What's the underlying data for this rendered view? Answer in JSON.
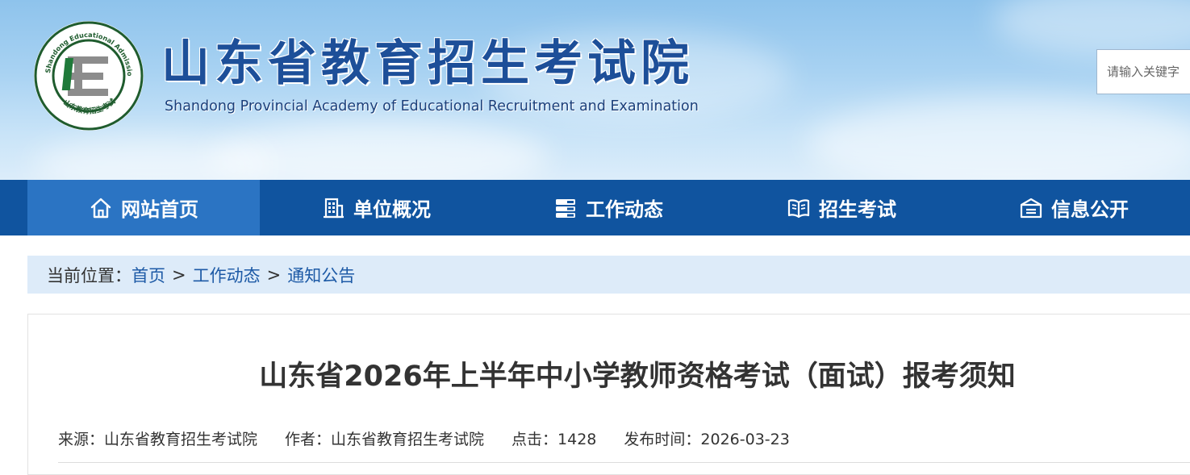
{
  "header": {
    "brand_cn": "山东省教育招生考试院",
    "brand_en": "Shandong Provincial Academy of Educational Recruitment and Examination",
    "logo": {
      "ring_text_top": "Shandong Educational Admission & Examination",
      "ring_text_bottom": "山东教育招生考试",
      "icon": "sdeea-logo-icon"
    },
    "search_placeholder": "请输入关键字"
  },
  "nav": {
    "items": [
      {
        "label": "网站首页",
        "icon": "home-icon",
        "active": true
      },
      {
        "label": "单位概况",
        "icon": "building-icon",
        "active": false
      },
      {
        "label": "工作动态",
        "icon": "news-list-icon",
        "active": false
      },
      {
        "label": "招生考试",
        "icon": "book-icon",
        "active": false
      },
      {
        "label": "信息公开",
        "icon": "info-box-icon",
        "active": false
      }
    ]
  },
  "breadcrumb": {
    "prefix": "当前位置：",
    "items": [
      "首页",
      "工作动态",
      "通知公告"
    ],
    "separator": ">"
  },
  "article": {
    "title": "山东省2026年上半年中小学教师资格考试（面试）报考须知",
    "meta": {
      "source": "来源：山东省教育招生考试院",
      "author": "作者：山东省教育招生考试院",
      "clicks": "点击：1428",
      "date": "发布时间：2026-03-23"
    }
  },
  "colors": {
    "nav_bg": "#10549f",
    "nav_active": "#2b74c3",
    "brand_blue": "#1d4f99",
    "breadcrumb_bg": "#ddebf9",
    "link": "#1d5aa6"
  }
}
